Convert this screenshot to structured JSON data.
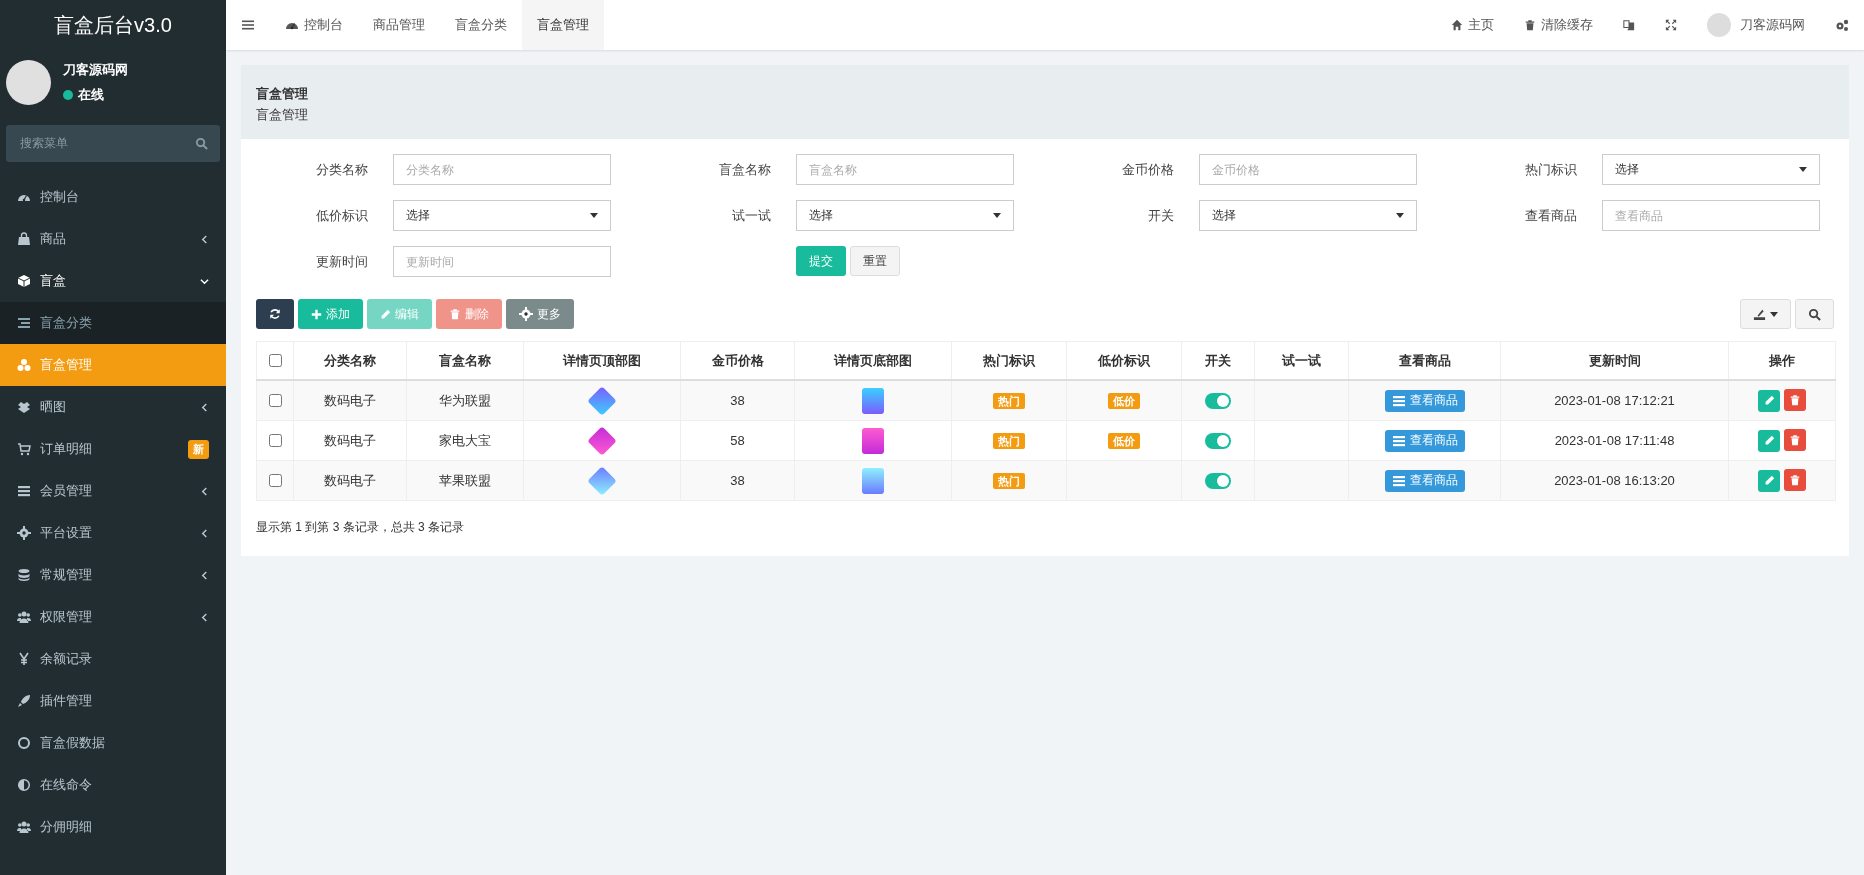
{
  "sidebar": {
    "logo": "盲盒后台v3.0",
    "user": {
      "name": "刀客源码网",
      "status": "在线"
    },
    "search": {
      "placeholder": "搜索菜单"
    },
    "items": [
      {
        "label": "控制台",
        "selected": false
      },
      {
        "label": "商品",
        "selected": false,
        "expanded": false
      },
      {
        "label": "盲盒",
        "selected": false,
        "expanded": true,
        "children": [
          {
            "label": "盲盒分类",
            "selected": false
          },
          {
            "label": "盲盒管理",
            "selected": true
          }
        ]
      },
      {
        "label": "晒图",
        "selected": false,
        "expanded": false
      },
      {
        "label": "订单明细",
        "selected": false,
        "badge": "新"
      },
      {
        "label": "会员管理",
        "selected": false,
        "expanded": false
      },
      {
        "label": "平台设置",
        "selected": false,
        "expanded": false
      },
      {
        "label": "常规管理",
        "selected": false,
        "expanded": false
      },
      {
        "label": "权限管理",
        "selected": false,
        "expanded": false
      },
      {
        "label": "余额记录",
        "selected": false
      },
      {
        "label": "插件管理",
        "selected": false
      },
      {
        "label": "盲盒假数据",
        "selected": false
      },
      {
        "label": "在线命令",
        "selected": false
      },
      {
        "label": "分佣明细",
        "selected": false
      }
    ]
  },
  "topbar": {
    "tabs": [
      {
        "label": "控制台",
        "selected": false
      },
      {
        "label": "商品管理",
        "selected": false
      },
      {
        "label": "盲盒分类",
        "selected": false
      },
      {
        "label": "盲盒管理",
        "selected": true
      }
    ],
    "links": [
      "主页",
      "清除缓存"
    ],
    "user": "刀客源码网"
  },
  "panel": {
    "title": "盲盒管理",
    "subtitle": "盲盒管理",
    "filters": [
      {
        "label": "分类名称",
        "kind": "text",
        "placeholder": "分类名称"
      },
      {
        "label": "盲盒名称",
        "kind": "text",
        "placeholder": "盲盒名称"
      },
      {
        "label": "金币价格",
        "kind": "text",
        "placeholder": "金币价格"
      },
      {
        "label": "热门标识",
        "kind": "select",
        "value": "选择"
      },
      {
        "label": "低价标识",
        "kind": "select",
        "value": "选择"
      },
      {
        "label": "试一试",
        "kind": "select",
        "value": "选择"
      },
      {
        "label": "开关",
        "kind": "select",
        "value": "选择"
      },
      {
        "label": "查看商品",
        "kind": "text",
        "placeholder": "查看商品"
      },
      {
        "label": "更新时间",
        "kind": "text",
        "placeholder": "更新时间"
      }
    ],
    "form_buttons": [
      "提交",
      "重置"
    ],
    "toolbar": [
      {
        "kind": "refresh",
        "disabled": false
      },
      {
        "kind": "add",
        "label": "添加",
        "disabled": false
      },
      {
        "kind": "edit",
        "label": "编辑",
        "disabled": true
      },
      {
        "kind": "delete",
        "label": "删除",
        "disabled": true
      },
      {
        "kind": "more",
        "label": "更多",
        "disabled": false
      }
    ],
    "table": {
      "header_checked": false,
      "columns": [
        "分类名称",
        "盲盒名称",
        "详情页顶部图",
        "金币价格",
        "详情页底部图",
        "热门标识",
        "低价标识",
        "开关",
        "试一试",
        "查看商品",
        "更新时间",
        "操作"
      ],
      "rows": [
        {
          "checked": false,
          "category": "数码电子",
          "name": "华为联盟",
          "price": "38",
          "hot": "热门",
          "low": "低价",
          "on": true,
          "view": "查看商品",
          "updated": "2023-01-08 17:12:21"
        },
        {
          "checked": false,
          "category": "数码电子",
          "name": "家电大宝",
          "price": "58",
          "hot": "热门",
          "low": "低价",
          "on": true,
          "view": "查看商品",
          "updated": "2023-01-08 17:11:48"
        },
        {
          "checked": false,
          "category": "数码电子",
          "name": "苹果联盟",
          "price": "38",
          "hot": "热门",
          "on": true,
          "view": "查看商品",
          "updated": "2023-01-08 16:13:20"
        }
      ]
    },
    "footer": "显示第 1 到第 3 条记录，总共 3 条记录"
  }
}
